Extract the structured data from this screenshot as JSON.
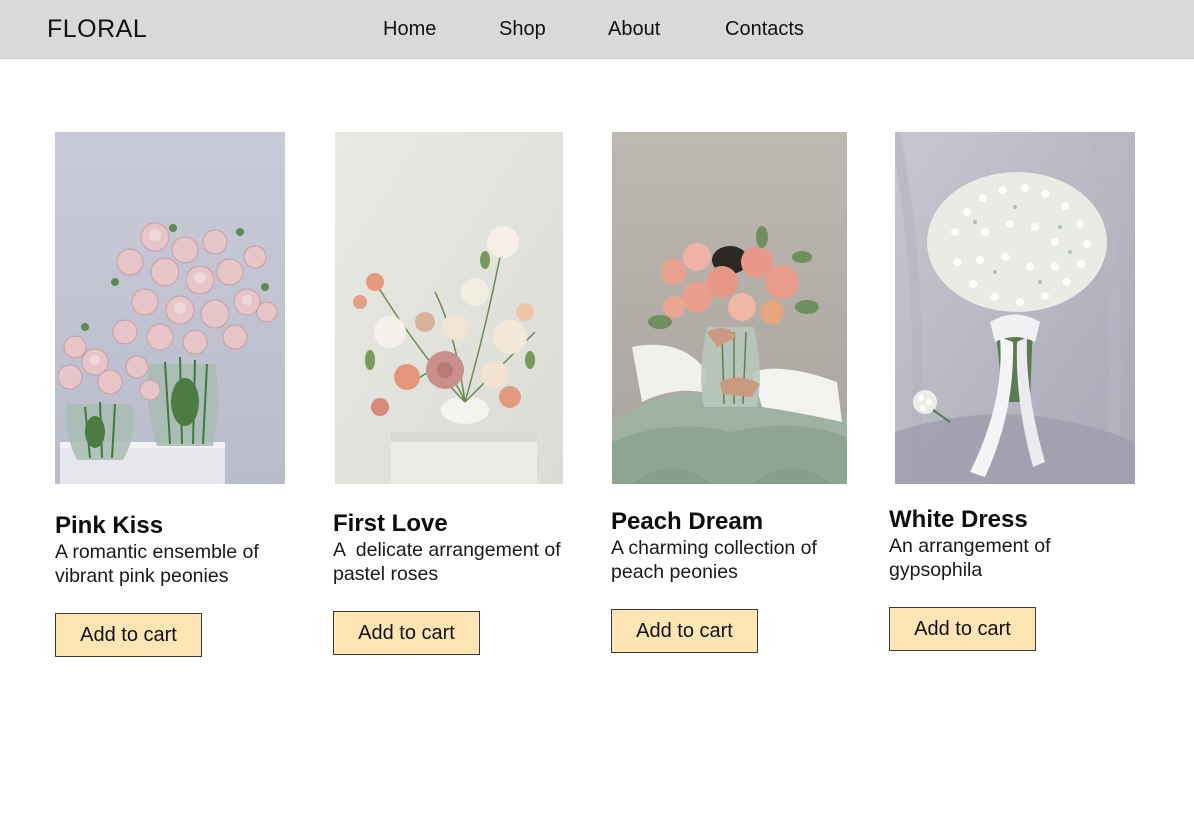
{
  "header": {
    "logo": "FLORAL",
    "nav": [
      {
        "label": "Home"
      },
      {
        "label": "Shop"
      },
      {
        "label": "About"
      },
      {
        "label": "Contacts"
      }
    ]
  },
  "products": [
    {
      "name": "Pink Kiss",
      "description": "A romantic ensemble of vibrant pink peonies",
      "button_label": "Add to cart",
      "image_icon": "pink-peonies-vases-photo"
    },
    {
      "name": "First Love",
      "description": "A  delicate arrangement of pastel roses",
      "button_label": "Add to cart",
      "image_icon": "pastel-roses-arrangement-photo"
    },
    {
      "name": "Peach Dream",
      "description": "A charming collection of peach peonies",
      "button_label": "Add to cart",
      "image_icon": "peach-peonies-bouquet-photo"
    },
    {
      "name": "White Dress",
      "description": "An arrangement of gypsophila",
      "button_label": "Add to cart",
      "image_icon": "gypsophila-bouquet-photo"
    }
  ],
  "colors": {
    "header_bg": "#d9d9d9",
    "button_bg": "#ffe5b3",
    "button_border": "#3a3a3a"
  }
}
